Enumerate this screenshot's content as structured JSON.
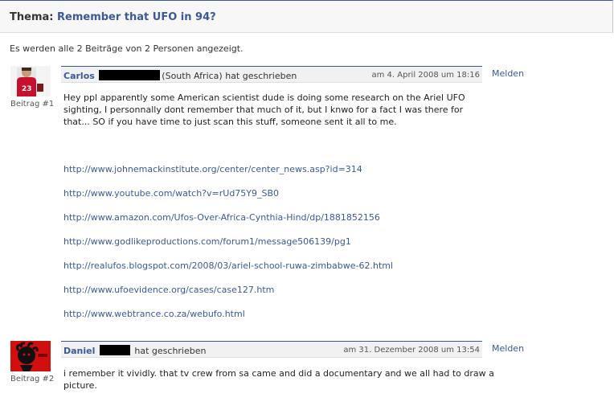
{
  "header": {
    "label": "Thema:",
    "topic": "Remember that UFO in 94?"
  },
  "summary": "Es werden alle 2 Beiträge von 2 Personen angezeigt.",
  "posts": [
    {
      "author": "Carlos",
      "location": "(South Africa)",
      "wrote": "hat geschrieben",
      "date": "am 4. April 2008 um 18:16",
      "report": "Melden",
      "index": "Beitrag #1",
      "text": "Hey ppl apparently some American scientist dude is doing some research on the Ariel UFO sighting, I personnally dont remember that much of it, but I knwo for a fact I was there for that... SO if you have time to just scan this stuff, someone sent it all to me.",
      "links": [
        "http://www.johnemackinstitute.org/center/center_news.asp?id=314",
        "http://www.youtube.com/watch?v=rUd75Y9_SB0",
        "http://www.amazon.com/Ufos-Over-Africa-Cynthia-Hind/dp/1881852156",
        "http://www.godlikeproductions.com/forum1/message506139/pg1",
        "http://realufos.blogspot.com/2008/03/ariel-school-ruwa-zimbabwe-62.html",
        "http://www.ufoevidence.org/cases/case127.htm",
        "http://www.webtrance.co.za/webufo.html"
      ]
    },
    {
      "author": "Daniel",
      "wrote": "hat geschrieben",
      "date": "am 31. Dezember 2008 um 13:54",
      "report": "Melden",
      "index": "Beitrag #2",
      "text": "i remember it vividly. that tv crew from sa came and did a documentary and we all had to draw a picture."
    }
  ],
  "colors": {
    "link": "#3b5998",
    "header_border": "#3b5998",
    "header_bg": "#f1f1f1"
  }
}
